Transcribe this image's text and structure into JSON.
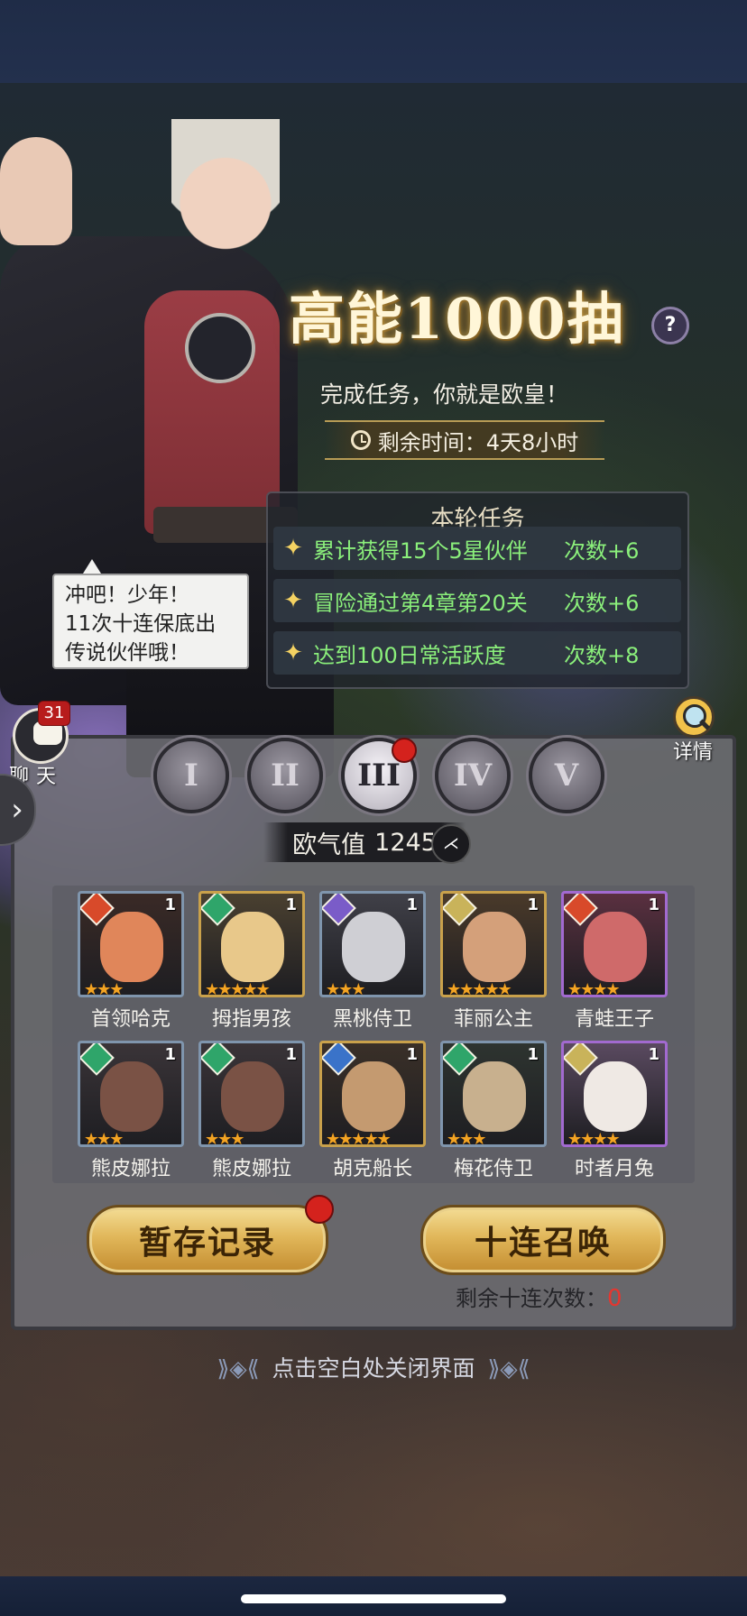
{
  "event": {
    "title": "高能1000抽",
    "help_icon": "?",
    "subtitle": "完成任务，你就是欧皇！",
    "timer_label": "剩余时间：4天8小时"
  },
  "tasks": {
    "header": "本轮任务",
    "items": [
      {
        "label": "累计获得15个5星伙伴",
        "reward": "次数+6"
      },
      {
        "label": "冒险通过第4章第20关",
        "reward": "次数+6"
      },
      {
        "label": "达到100日常活跃度",
        "reward": "次数+8"
      }
    ]
  },
  "speech_bubble": {
    "lines": [
      "冲吧！少年！",
      "11次十连保底出",
      "传说伙伴哦！"
    ]
  },
  "chat": {
    "badge": "31",
    "label": "聊天"
  },
  "side_arrow": "›",
  "details": {
    "label": "详情"
  },
  "tiers": {
    "items": [
      "I",
      "II",
      "III",
      "IV",
      "V"
    ],
    "active": "III"
  },
  "luck": {
    "label": "欧气值",
    "value": "1245"
  },
  "heroes": [
    {
      "name": "首领哈克",
      "level": "1",
      "stars": 3,
      "element": "fire",
      "frame": "blue"
    },
    {
      "name": "拇指男孩",
      "level": "1",
      "stars": 5,
      "element": "nature",
      "frame": "gold"
    },
    {
      "name": "黑桃侍卫",
      "level": "1",
      "stars": 3,
      "element": "moon",
      "frame": "blue"
    },
    {
      "name": "菲丽公主",
      "level": "1",
      "stars": 5,
      "element": "light",
      "frame": "gold"
    },
    {
      "name": "青蛙王子",
      "level": "1",
      "stars": 4,
      "element": "fire",
      "frame": "purple"
    },
    {
      "name": "熊皮娜拉",
      "level": "1",
      "stars": 3,
      "element": "nature",
      "frame": "blue"
    },
    {
      "name": "熊皮娜拉",
      "level": "1",
      "stars": 3,
      "element": "nature",
      "frame": "blue"
    },
    {
      "name": "胡克船长",
      "level": "1",
      "stars": 5,
      "element": "water",
      "frame": "gold"
    },
    {
      "name": "梅花侍卫",
      "level": "1",
      "stars": 3,
      "element": "nature",
      "frame": "blue"
    },
    {
      "name": "时者月兔",
      "level": "1",
      "stars": 4,
      "element": "light",
      "frame": "purple"
    }
  ],
  "buttons": {
    "save_record": "暂存记录",
    "ten_pull": "十连召唤"
  },
  "remaining": {
    "label": "剩余十连次数：",
    "count": "0"
  },
  "close_hint": "点击空白处关闭界面",
  "colors": {
    "fire": "#d84a2a",
    "nature": "#2fa56a",
    "moon": "#7a5cc8",
    "light": "#c9b35a",
    "water": "#3a73c9",
    "task_text": "#8bf07b",
    "accent_gold": "#e1b75a"
  }
}
